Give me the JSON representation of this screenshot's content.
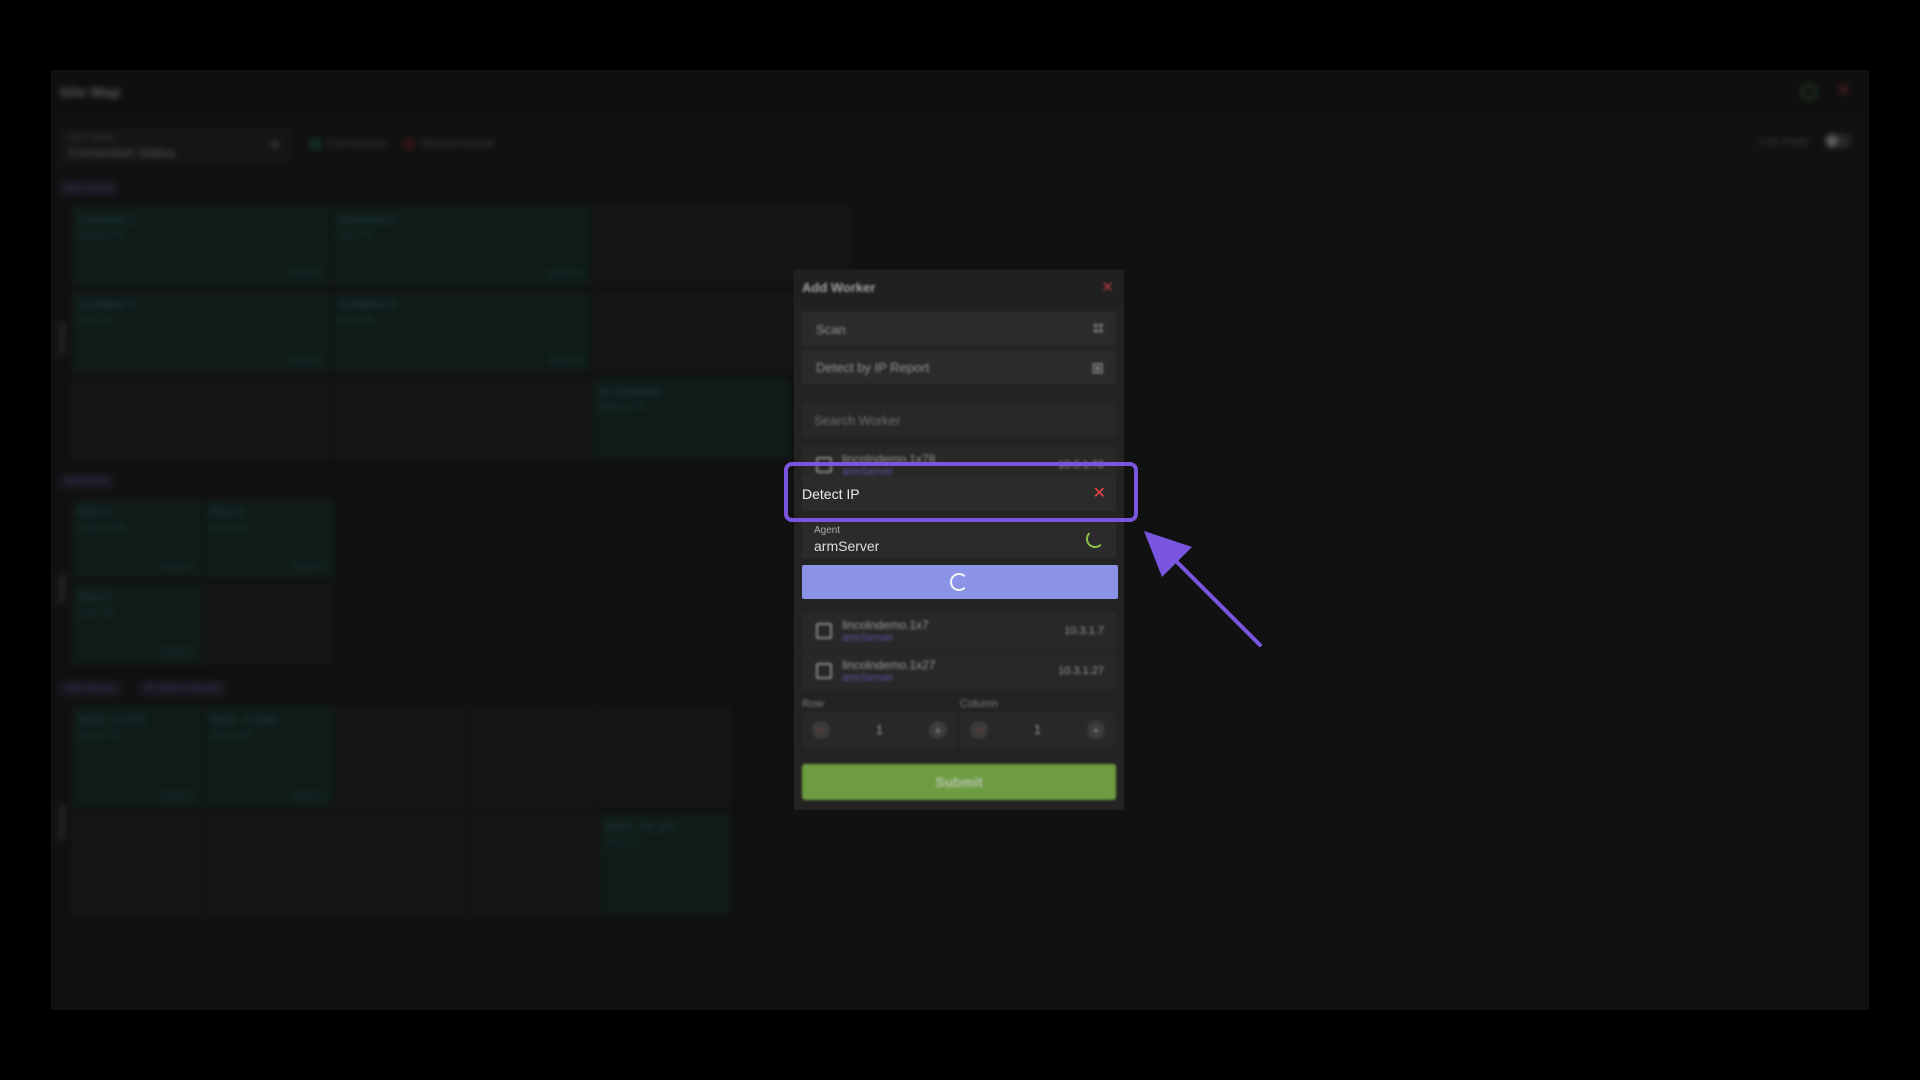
{
  "app": {
    "title": "Site Map",
    "view_mode_label": "View Mode",
    "view_mode_value": "Connection Status",
    "legend": [
      "Connected",
      "Disconnected"
    ],
    "live_mode_label": "Live mode",
    "sections": [
      {
        "tag": "Add Group",
        "vertical": "Groups",
        "cells": [
          {
            "name": "Container 1",
            "sub": "195.96 TH",
            "issues": "Issues 0"
          },
          {
            "name": "Container 2",
            "sub": "0.00 TH",
            "issues": "Issues 0"
          },
          {
            "name": "Container 3",
            "sub": "0.00 TH",
            "issues": "Issues 0"
          },
          {
            "name": "Container 4",
            "sub": "0.00 TH",
            "issues": "Issues 0"
          },
          {
            "name": "Air Container",
            "sub": "439.66 TH",
            "issues": ""
          }
        ]
      },
      {
        "tag": "Add Rack",
        "vertical": "Racks",
        "cells": [
          {
            "name": "PDU 1",
            "sub": "439.66 TH",
            "issues": "Issues 0"
          },
          {
            "name": "PDU 2",
            "sub": "0.00 TH",
            "issues": "Issues 0"
          },
          {
            "name": "PDU 3",
            "sub": "0.00 TH",
            "issues": "Issues 0"
          }
        ]
      },
      {
        "tags": [
          "Add Device",
          "IP Detect Wizard"
        ],
        "vertical": "Devices",
        "cells": [
          {
            "name": "lincol...o.1x78",
            "sub": "10.3.1.78",
            "issues": "Issues 0"
          },
          {
            "name": "lincol...o.1x82",
            "sub": "10.3.1.82",
            "issues": "Issues 0"
          },
          {
            "name": "lincol...mo.1x7",
            "sub": "10.3.1.7",
            "issues": "Issues 0"
          }
        ]
      }
    ]
  },
  "dialog": {
    "title": "Add Worker",
    "options": [
      {
        "label": "Scan"
      },
      {
        "label": "Detect by IP Report"
      }
    ],
    "search_placeholder": "Search Worker",
    "workers": [
      {
        "name": "lincolndemo.1x78",
        "agent": "armServer",
        "ip": "10.3.1.78"
      },
      {
        "name": "lincolndemo.1x7",
        "agent": "armServer",
        "ip": "10.3.1.7"
      },
      {
        "name": "lincolndemo.1x27",
        "agent": "armServer",
        "ip": "10.3.1.27"
      }
    ],
    "row_label": "Row",
    "column_label": "Column",
    "row_value": "1",
    "column_value": "1",
    "submit_label": "Submit"
  },
  "detect_ip": {
    "title": "Detect IP",
    "agent_label": "Agent",
    "agent_value": "armServer"
  },
  "colors": {
    "highlight": "#7a56e0",
    "submit": "#86c64a",
    "loading_button": "#8a93e6",
    "close": "#e44444"
  }
}
